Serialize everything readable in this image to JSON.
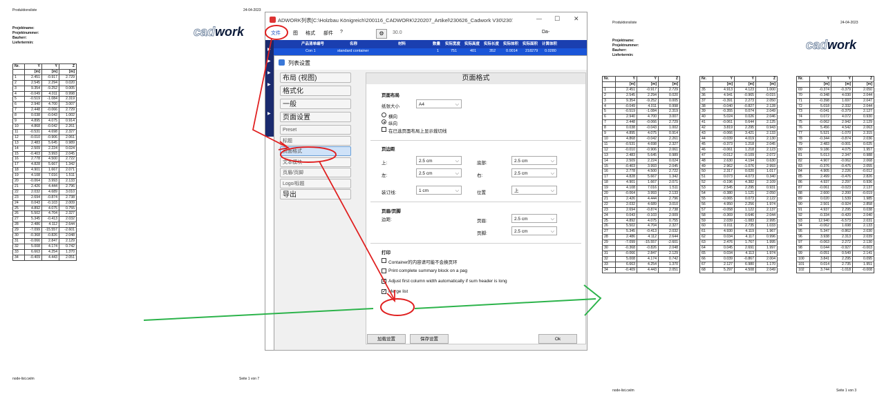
{
  "left_page": {
    "title": "Produktionsliste",
    "date": "24-04-2023",
    "project_labels": [
      "Projektname:",
      "Projektnummer:",
      "Bauherr:",
      "Liefertermin:"
    ],
    "logo_a": "cad",
    "logo_b": "work",
    "footer_left": "node-list.cwlm",
    "footer_right": "Seite 1 von 7"
  },
  "right_page": {
    "title": "Produktionsliste",
    "date": "24-04-2023",
    "project_labels": [
      "Projektname:",
      "Projektnummer:",
      "Bauherr:",
      "Liefertermin:"
    ],
    "logo_a": "cad",
    "logo_b": "work",
    "footer_left": "node-list.cwlm",
    "footer_right": "Seite 1 von 3"
  },
  "table_headers": [
    "Nr.",
    "Y",
    "Y",
    "Z"
  ],
  "table_units": [
    "",
    "[m]",
    "[m]",
    "[m]"
  ],
  "rows": [
    [
      "1",
      "2.451",
      "-0.917",
      "2.729"
    ],
    [
      "2",
      "2.545",
      "2.294",
      "0.020"
    ],
    [
      "3",
      "9.354",
      "-9.252",
      "0.005"
    ],
    [
      "4",
      "-0.049",
      "4.011",
      "0.998"
    ],
    [
      "5",
      "-0.519",
      "-1.084",
      "2.319"
    ],
    [
      "6",
      "2.940",
      "4.700",
      "3.007"
    ],
    [
      "7",
      "2.448",
      "-0.066",
      "2.729"
    ],
    [
      "8",
      "0.038",
      "-0.043",
      "1.002"
    ],
    [
      "9",
      "4.895",
      "4.075",
      "0.914"
    ],
    [
      "10",
      "4.868",
      "-0.042",
      "2.261"
    ],
    [
      "11",
      "-0.531",
      "4.698",
      "2.327"
    ],
    [
      "12",
      "-0.010",
      "-0.906",
      "2.061"
    ],
    [
      "13",
      "2.483",
      "5.645",
      "0.989"
    ],
    [
      "14",
      "2.509",
      "2.224",
      "0.024"
    ],
    [
      "15",
      "-0.403",
      "3.993",
      "2.045"
    ],
    [
      "16",
      "2.778",
      "4.500",
      "2.722"
    ],
    [
      "17",
      "4.828",
      "5.667",
      "1.342"
    ],
    [
      "18",
      "4.901",
      "1.667",
      "2.071"
    ],
    [
      "19",
      "4.108",
      "7.016",
      "1.511"
    ],
    [
      "20",
      "-0.064",
      "3.993",
      "2.133"
    ],
    [
      "21",
      "2.426",
      "4.444",
      "2.796"
    ],
    [
      "22",
      "2.032",
      "4.689",
      "3.010"
    ],
    [
      "23",
      "2.694",
      "-0.874",
      "2.738"
    ],
    [
      "24",
      "0.043",
      "-0.103",
      "2.009"
    ],
    [
      "25",
      "4.892",
      "4.075",
      "0.755"
    ],
    [
      "26",
      "5.502",
      "4.704",
      "2.327"
    ],
    [
      "27",
      "5.345",
      "-0.413",
      "2.032"
    ],
    [
      "28",
      "2.486",
      "4.112",
      "2.644"
    ],
    [
      "29",
      "-7.099",
      "-15.557",
      "-2.601"
    ],
    [
      "30",
      "-0.368",
      "-0.826",
      "2.048"
    ],
    [
      "31",
      "-0.066",
      "2.847",
      "2.129"
    ],
    [
      "32",
      "5.008",
      "4.174",
      "0.742"
    ],
    [
      "33",
      "6.663",
      "4.254",
      "1.370"
    ],
    [
      "34",
      "-0.409",
      "4.443",
      "2.051"
    ]
  ],
  "rows_b": [
    [
      "35",
      "4.913",
      "4.123",
      "1.000"
    ],
    [
      "36",
      "4.941",
      "-0.965",
      "-0.015"
    ],
    [
      "37",
      "-0.391",
      "2.273",
      "2.050"
    ],
    [
      "38",
      "-0.040",
      "-0.827",
      "2.128"
    ],
    [
      "39",
      "-0.355",
      "0.074",
      "2.049"
    ],
    [
      "40",
      "5.024",
      "0.026",
      "2.046"
    ],
    [
      "41",
      "-0.061",
      "0.644",
      "2.125"
    ],
    [
      "42",
      "3.819",
      "2.295",
      "0.943"
    ],
    [
      "43",
      "-0.066",
      "3.421",
      "2.133"
    ],
    [
      "44",
      "-0.039",
      "4.019",
      "2.130"
    ],
    [
      "45",
      "-0.373",
      "1.218",
      "2.045"
    ],
    [
      "46",
      "-0.061",
      "1.218",
      "2.123"
    ],
    [
      "47",
      "-0.012",
      "-0.109",
      "2.072"
    ],
    [
      "48",
      "2.630",
      "4.194",
      "0.630"
    ],
    [
      "49",
      "2.962",
      "-1.076",
      "2.993"
    ],
    [
      "50",
      "2.317",
      "0.020",
      "1.017"
    ],
    [
      "51",
      "0.073",
      "4.073",
      "0.340"
    ],
    [
      "52",
      "-0.196",
      "4.382",
      "2.109"
    ],
    [
      "53",
      "2.545",
      "2.295",
      "0.931"
    ],
    [
      "54",
      "-0.380",
      "1.121",
      "2.050"
    ],
    [
      "55",
      "-0.065",
      "0.073",
      "2.122"
    ],
    [
      "56",
      "4.950",
      "2.256",
      "1.974"
    ],
    [
      "57",
      "-0.058",
      "1.122",
      "2.137"
    ],
    [
      "58",
      "-0.369",
      "0.646",
      "2.044"
    ],
    [
      "59",
      "2.039",
      "-1.083",
      "2.995"
    ],
    [
      "60",
      "0.011",
      "2.735",
      "1.033"
    ],
    [
      "61",
      "4.930",
      "4.119",
      "1.967"
    ],
    [
      "62",
      "0.034",
      "4.117",
      "0.996"
    ],
    [
      "63",
      "2.476",
      "1.767",
      "1.995"
    ],
    [
      "64",
      "0.045",
      "2.691",
      "1.997"
    ],
    [
      "65",
      "0.034",
      "4.113",
      "1.974"
    ],
    [
      "66",
      "0.039",
      "-0.867",
      "2.004"
    ],
    [
      "67",
      "2.127",
      "6.980",
      "1.170"
    ],
    [
      "68",
      "5.297",
      "4.508",
      "2.049"
    ]
  ],
  "rows_c": [
    [
      "69",
      "-0.374",
      "-0.379",
      "2.050"
    ],
    [
      "70",
      "-0.348",
      "4.030",
      "2.044"
    ],
    [
      "71",
      "-0.398",
      "1.697",
      "2.047"
    ],
    [
      "72",
      "5.018",
      "2.332",
      "2.044"
    ],
    [
      "73",
      "-0.041",
      "-0.379",
      "2.127"
    ],
    [
      "74",
      "0.072",
      "4.072",
      "0.930"
    ],
    [
      "75",
      "-0.062",
      "2.942",
      "2.129"
    ],
    [
      "76",
      "5.456",
      "4.542",
      "2.063"
    ],
    [
      "77",
      "5.521",
      "-1.070",
      "2.315"
    ],
    [
      "78",
      "-0.344",
      "-0.874",
      "2.036"
    ],
    [
      "79",
      "2.483",
      "-0.001",
      "0.025"
    ],
    [
      "80",
      "9.186",
      "4.075",
      "1.957"
    ],
    [
      "81",
      "5.013",
      "2.347",
      "0.988"
    ],
    [
      "82",
      "4.907",
      "-0.062",
      "2.068"
    ],
    [
      "83",
      "-0.376",
      "-0.475",
      "2.055"
    ],
    [
      "84",
      "4.905",
      "2.226",
      "-0.012"
    ],
    [
      "85",
      "2.499",
      "-0.476",
      "2.826"
    ],
    [
      "86",
      "4.937",
      "2.297",
      "0.936"
    ],
    [
      "87",
      "-0.061",
      "-0.023",
      "2.137"
    ],
    [
      "88",
      "2.600",
      "2.200",
      "-0.019"
    ],
    [
      "89",
      "0.020",
      "1.539",
      "1.985"
    ],
    [
      "90",
      "2.501",
      "-0.924",
      "2.858"
    ],
    [
      "91",
      "4.937",
      "2.295",
      "0.038"
    ],
    [
      "92",
      "-0.334",
      "-0.420",
      "2.040"
    ],
    [
      "93",
      "12.940",
      "-6.573",
      "2.031"
    ],
    [
      "94",
      "-0.062",
      "1.698",
      "2.133"
    ],
    [
      "95",
      "5.347",
      "-0.862",
      "2.030"
    ],
    [
      "96",
      "3.938",
      "2.313",
      "2.039"
    ],
    [
      "97",
      "-0.063",
      "2.272",
      "2.130"
    ],
    [
      "98",
      "0.044",
      "-0.927",
      "-0.003"
    ],
    [
      "99",
      "-0.051",
      "0.549",
      "2.141"
    ],
    [
      "100",
      "3.841",
      "2.295",
      "0.095"
    ],
    [
      "101",
      "0.014",
      "2.735",
      "1.951"
    ],
    [
      "102",
      "3.744",
      "-1.018",
      "-0.008"
    ]
  ],
  "window": {
    "icon_label": "Da",
    "title": "ADWORK列表[C:\\Holzbau Königreich\\200116_CADWORK\\220207_Artikel\\230626_Cadwork V30\\230705_V...",
    "minimize": "—",
    "maximize": "☐",
    "close": "✕",
    "menu": [
      "文件",
      "图",
      "格式",
      "部件",
      "?"
    ],
    "zoom": "30.0",
    "right_label": "Da-",
    "grid_headers": [
      "产品清单编号",
      "名称",
      "材料",
      "数量",
      "实际宽度",
      "实际高度",
      "实际长度",
      "实际体积",
      "实际面积",
      "计算体积"
    ],
    "grid_row": [
      "Con 1",
      "standard container",
      "",
      "1",
      "751",
      "401",
      "352",
      "0.0014",
      "218279",
      "0.0280"
    ],
    "row_arrow": "▶"
  },
  "dialog": {
    "title": "列表设置",
    "nav": [
      {
        "label": "布局 (视图)",
        "small": false
      },
      {
        "label": "格式化",
        "small": false
      },
      {
        "label": "一般",
        "small": false
      },
      {
        "label": "页面设置",
        "small": false
      },
      {
        "label": "Preset",
        "small": true
      },
      {
        "label": "标题",
        "small": true
      },
      {
        "label": "页面格式",
        "small": true
      },
      {
        "label": "文本模块",
        "small": true
      },
      {
        "label": "页眉/页脚",
        "small": true
      },
      {
        "label": "Logo/标题",
        "small": true
      },
      {
        "label": "导出",
        "small": false
      }
    ],
    "content_title": "页面格式",
    "page_layout": "页面布局",
    "paper_size_label": "纸张大小",
    "paper_size": "A4",
    "landscape": "横向",
    "portrait": "纵向",
    "show_lines_label": "在已选页面布局上显示裁切线",
    "margins_title": "页边距",
    "top_label": "上:",
    "top_value": "2.5 cm",
    "bottom_label": "底部:",
    "bottom_value": "2.5 cm",
    "left_label": "左:",
    "left_value": "2.5 cm",
    "right_label": "右:",
    "right_value": "2.5 cm",
    "gutter_label": "装订线:",
    "gutter_value": "1 cm",
    "position_label": "位置",
    "position_value": "上",
    "hf_title": "页眉/页脚",
    "edge_label": "边距:",
    "header_label": "页眉:",
    "header_value": "2.5 cm",
    "footer_label": "页脚:",
    "footer_value": "2.5 cm",
    "print_title": "打印",
    "print_opt1": "Container的内容请可能不会换页环",
    "print_opt2": "Print complete summary block on a pag",
    "print_opt3": "Adjust first column width automatically if sum header is long",
    "print_opt4": "Merge list",
    "load_btn": "加载设置",
    "save_btn": "保存设置",
    "ok_btn": "Ok"
  },
  "colors": {
    "annotation_red": "#e02020",
    "annotation_green": "#2bb34a",
    "grid_header": "#1a3fb0",
    "selection": "#cfe2f8"
  },
  "icons": [
    "window-app-icon",
    "minimize-icon",
    "maximize-icon",
    "close-icon",
    "gear-icon",
    "dialog-icon",
    "chevron-down-icon",
    "checkbox-checked-icon"
  ]
}
